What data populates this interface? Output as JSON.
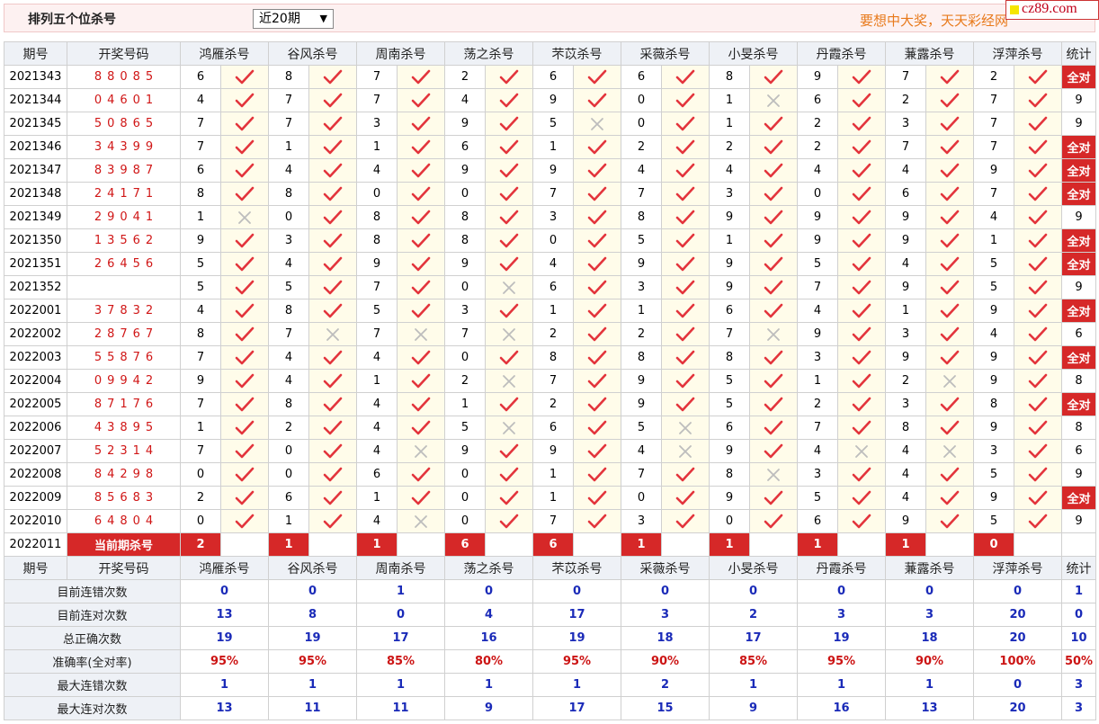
{
  "header": {
    "title": "排列五个位杀号",
    "range": "近20期",
    "slogan": "要想中大奖，天天彩经网"
  },
  "logo": {
    "text": "cz89.com"
  },
  "columns": [
    "期号",
    "开奖号码",
    "鸿雁杀号",
    "谷风杀号",
    "周南杀号",
    "荡之杀号",
    "芣苡杀号",
    "采薇杀号",
    "小旻杀号",
    "丹霞杀号",
    "蒹露杀号",
    "浮萍杀号",
    "统计"
  ],
  "rows": [
    {
      "issue": "2021343",
      "draw": "88085",
      "kills": [
        6,
        8,
        7,
        2,
        6,
        6,
        8,
        9,
        7,
        2
      ],
      "ok": [
        1,
        1,
        1,
        1,
        1,
        1,
        1,
        1,
        1,
        1
      ],
      "total": "全对"
    },
    {
      "issue": "2021344",
      "draw": "04601",
      "kills": [
        4,
        7,
        7,
        4,
        9,
        0,
        1,
        6,
        2,
        7
      ],
      "ok": [
        1,
        1,
        1,
        1,
        1,
        1,
        0,
        1,
        1,
        1
      ],
      "total": "9"
    },
    {
      "issue": "2021345",
      "draw": "50865",
      "kills": [
        7,
        7,
        3,
        9,
        5,
        0,
        1,
        2,
        3,
        7
      ],
      "ok": [
        1,
        1,
        1,
        1,
        0,
        1,
        1,
        1,
        1,
        1
      ],
      "total": "9"
    },
    {
      "issue": "2021346",
      "draw": "34399",
      "kills": [
        7,
        1,
        1,
        6,
        1,
        2,
        2,
        2,
        7,
        7
      ],
      "ok": [
        1,
        1,
        1,
        1,
        1,
        1,
        1,
        1,
        1,
        1
      ],
      "total": "全对"
    },
    {
      "issue": "2021347",
      "draw": "83987",
      "kills": [
        6,
        4,
        4,
        9,
        9,
        4,
        4,
        4,
        4,
        9
      ],
      "ok": [
        1,
        1,
        1,
        1,
        1,
        1,
        1,
        1,
        1,
        1
      ],
      "total": "全对"
    },
    {
      "issue": "2021348",
      "draw": "24171",
      "kills": [
        8,
        8,
        0,
        0,
        7,
        7,
        3,
        0,
        6,
        7
      ],
      "ok": [
        1,
        1,
        1,
        1,
        1,
        1,
        1,
        1,
        1,
        1
      ],
      "total": "全对"
    },
    {
      "issue": "2021349",
      "draw": "29041",
      "kills": [
        1,
        0,
        8,
        8,
        3,
        8,
        9,
        9,
        9,
        4
      ],
      "ok": [
        0,
        1,
        1,
        1,
        1,
        1,
        1,
        1,
        1,
        1
      ],
      "total": "9"
    },
    {
      "issue": "2021350",
      "draw": "13562",
      "kills": [
        9,
        3,
        8,
        8,
        0,
        5,
        1,
        9,
        9,
        1
      ],
      "ok": [
        1,
        1,
        1,
        1,
        1,
        1,
        1,
        1,
        1,
        1
      ],
      "total": "全对"
    },
    {
      "issue": "2021351",
      "draw": "26456",
      "kills": [
        5,
        4,
        9,
        9,
        4,
        9,
        9,
        5,
        4,
        5
      ],
      "ok": [
        1,
        1,
        1,
        1,
        1,
        1,
        1,
        1,
        1,
        1
      ],
      "total": "全对"
    },
    {
      "issue": "2021352",
      "draw": "",
      "kills": [
        5,
        5,
        7,
        0,
        6,
        3,
        9,
        7,
        9,
        5
      ],
      "ok": [
        1,
        1,
        1,
        0,
        1,
        1,
        1,
        1,
        1,
        1
      ],
      "total": "9"
    },
    {
      "issue": "2022001",
      "draw": "37832",
      "kills": [
        4,
        8,
        5,
        3,
        1,
        1,
        6,
        4,
        1,
        9
      ],
      "ok": [
        1,
        1,
        1,
        1,
        1,
        1,
        1,
        1,
        1,
        1
      ],
      "total": "全对"
    },
    {
      "issue": "2022002",
      "draw": "28767",
      "kills": [
        8,
        7,
        7,
        7,
        2,
        2,
        7,
        9,
        3,
        4
      ],
      "ok": [
        1,
        0,
        0,
        0,
        1,
        1,
        0,
        1,
        1,
        1
      ],
      "total": "6"
    },
    {
      "issue": "2022003",
      "draw": "55876",
      "kills": [
        7,
        4,
        4,
        0,
        8,
        8,
        8,
        3,
        9,
        9
      ],
      "ok": [
        1,
        1,
        1,
        1,
        1,
        1,
        1,
        1,
        1,
        1
      ],
      "total": "全对"
    },
    {
      "issue": "2022004",
      "draw": "09942",
      "kills": [
        9,
        4,
        1,
        2,
        7,
        9,
        5,
        1,
        2,
        9
      ],
      "ok": [
        1,
        1,
        1,
        0,
        1,
        1,
        1,
        1,
        0,
        1
      ],
      "total": "8"
    },
    {
      "issue": "2022005",
      "draw": "87176",
      "kills": [
        7,
        8,
        4,
        1,
        2,
        9,
        5,
        2,
        3,
        8
      ],
      "ok": [
        1,
        1,
        1,
        1,
        1,
        1,
        1,
        1,
        1,
        1
      ],
      "total": "全对"
    },
    {
      "issue": "2022006",
      "draw": "43895",
      "kills": [
        1,
        2,
        4,
        5,
        6,
        5,
        6,
        7,
        8,
        9
      ],
      "ok": [
        1,
        1,
        1,
        0,
        1,
        0,
        1,
        1,
        1,
        1
      ],
      "total": "8"
    },
    {
      "issue": "2022007",
      "draw": "52314",
      "kills": [
        7,
        0,
        4,
        9,
        9,
        4,
        9,
        4,
        4,
        3
      ],
      "ok": [
        1,
        1,
        0,
        1,
        1,
        0,
        1,
        0,
        0,
        1
      ],
      "total": "6"
    },
    {
      "issue": "2022008",
      "draw": "84298",
      "kills": [
        0,
        0,
        6,
        0,
        1,
        7,
        8,
        3,
        4,
        5
      ],
      "ok": [
        1,
        1,
        1,
        1,
        1,
        1,
        0,
        1,
        1,
        1
      ],
      "total": "9"
    },
    {
      "issue": "2022009",
      "draw": "85683",
      "kills": [
        2,
        6,
        1,
        0,
        1,
        0,
        9,
        5,
        4,
        9
      ],
      "ok": [
        1,
        1,
        1,
        1,
        1,
        1,
        1,
        1,
        1,
        1
      ],
      "total": "全对"
    },
    {
      "issue": "2022010",
      "draw": "64804",
      "kills": [
        0,
        1,
        4,
        0,
        7,
        3,
        0,
        6,
        9,
        5
      ],
      "ok": [
        1,
        1,
        0,
        1,
        1,
        1,
        1,
        1,
        1,
        1
      ],
      "total": "9"
    }
  ],
  "current": {
    "issue": "2022011",
    "label": "当前期杀号",
    "kills": [
      2,
      1,
      1,
      6,
      6,
      1,
      1,
      1,
      1,
      0
    ]
  },
  "stats": [
    {
      "label": "目前连错次数",
      "values": [
        "0",
        "0",
        "1",
        "0",
        "0",
        "0",
        "0",
        "0",
        "0",
        "0",
        "1"
      ],
      "color": "blue"
    },
    {
      "label": "目前连对次数",
      "values": [
        "13",
        "8",
        "0",
        "4",
        "17",
        "3",
        "2",
        "3",
        "3",
        "20",
        "0"
      ],
      "color": "blue"
    },
    {
      "label": "总正确次数",
      "values": [
        "19",
        "19",
        "17",
        "16",
        "19",
        "18",
        "17",
        "19",
        "18",
        "20",
        "10"
      ],
      "color": "blue"
    },
    {
      "label": "准确率(全对率)",
      "values": [
        "95%",
        "95%",
        "85%",
        "80%",
        "95%",
        "90%",
        "85%",
        "95%",
        "90%",
        "100%",
        "50%"
      ],
      "color": "red"
    },
    {
      "label": "最大连错次数",
      "values": [
        "1",
        "1",
        "1",
        "1",
        "1",
        "2",
        "1",
        "1",
        "1",
        "0",
        "3"
      ],
      "color": "blue"
    },
    {
      "label": "最大连对次数",
      "values": [
        "13",
        "11",
        "11",
        "9",
        "17",
        "15",
        "9",
        "16",
        "13",
        "20",
        "3"
      ],
      "color": "blue"
    }
  ],
  "icons": {
    "correct": "check-icon",
    "wrong": "cross-icon"
  },
  "colors": {
    "check": "#e3343c",
    "cross": "#bdbdbd",
    "red": "#d62828",
    "blue": "#1a2ab8"
  }
}
